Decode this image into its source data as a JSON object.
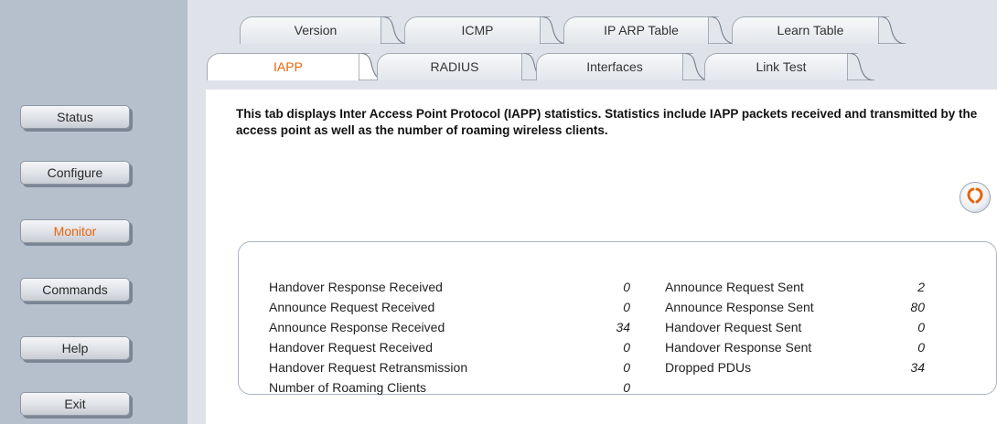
{
  "sidebar": {
    "items": [
      {
        "label": "Status",
        "active": false
      },
      {
        "label": "Configure",
        "active": false
      },
      {
        "label": "Monitor",
        "active": true
      },
      {
        "label": "Commands",
        "active": false
      },
      {
        "label": "Help",
        "active": false
      },
      {
        "label": "Exit",
        "active": false
      }
    ]
  },
  "tabs": {
    "row1": [
      {
        "label": "Version"
      },
      {
        "label": "ICMP"
      },
      {
        "label": "IP ARP Table"
      },
      {
        "label": "Learn Table"
      }
    ],
    "row2": [
      {
        "label": "IAPP",
        "active": true
      },
      {
        "label": "RADIUS"
      },
      {
        "label": "Interfaces"
      },
      {
        "label": "Link Test"
      }
    ]
  },
  "main": {
    "description": "This tab displays Inter Access Point Protocol (IAPP) statistics. Statistics include IAPP packets received and transmitted by the access point as well as the number of roaming wireless clients.",
    "refresh_icon": "refresh-icon",
    "stats_left": [
      {
        "label": "Handover Response Received",
        "value": "0"
      },
      {
        "label": "Announce Request Received",
        "value": "0"
      },
      {
        "label": "Announce Response Received",
        "value": "34"
      },
      {
        "label": "Handover Request Received",
        "value": "0"
      },
      {
        "label": "Handover Request Retransmission",
        "value": "0"
      },
      {
        "label": "Number of Roaming Clients",
        "value": "0"
      }
    ],
    "stats_right": [
      {
        "label": "Announce Request Sent",
        "value": "2"
      },
      {
        "label": "Announce Response Sent",
        "value": "80"
      },
      {
        "label": "Handover Request Sent",
        "value": "0"
      },
      {
        "label": "Handover Response Sent",
        "value": "0"
      },
      {
        "label": "Dropped PDUs",
        "value": "34"
      }
    ]
  },
  "colors": {
    "accent": "#e8640c",
    "sidebar_bg": "#b6c0cd"
  }
}
